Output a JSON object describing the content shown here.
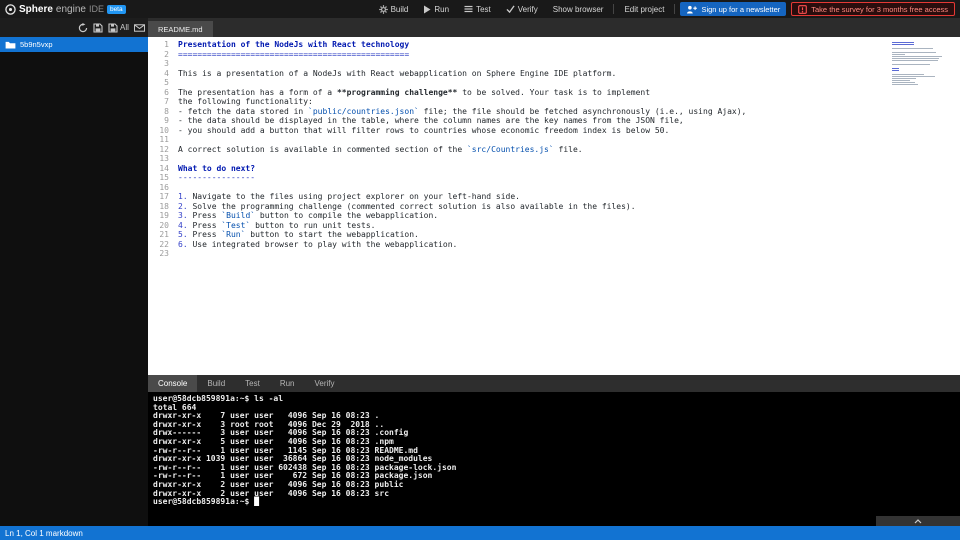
{
  "topbar": {
    "brand": {
      "name": "Sphere",
      "sub": "engine",
      "product": "IDE",
      "beta": "beta"
    },
    "actions": [
      {
        "label": "Build"
      },
      {
        "label": "Run"
      },
      {
        "label": "Test"
      },
      {
        "label": "Verify"
      },
      {
        "label": "Show browser"
      },
      {
        "label": "Edit project"
      }
    ],
    "newsletter_button": "Sign up for a newsletter",
    "survey_button": "Take the survey for 3 months free access"
  },
  "toolbar": {
    "save_all_label": "All"
  },
  "sidebar": {
    "items": [
      {
        "label": "5b9n5vxp"
      }
    ]
  },
  "editor": {
    "tab": "README.md",
    "lines": [
      [
        {
          "t": "Presentation of the NodeJs with React technology",
          "s": "h"
        }
      ],
      [
        {
          "t": "================================================",
          "s": "punct"
        }
      ],
      [],
      [
        {
          "t": "This is a presentation of a NodeJs with React webapplication on Sphere Engine IDE platform."
        }
      ],
      [],
      [
        {
          "t": "The presentation has a form of a "
        },
        {
          "t": "**programming challenge**",
          "s": "b"
        },
        {
          "t": " to be solved. Your task is to implement"
        }
      ],
      [
        {
          "t": "the following functionality:"
        }
      ],
      [
        {
          "t": "- fetch the data stored in "
        },
        {
          "t": "`public/countries.json`",
          "s": "code"
        },
        {
          "t": " file; the file should be fetched asynchronously (i.e., using Ajax),"
        }
      ],
      [
        {
          "t": "- the data should be displayed in the table, where the column names are the key names from the JSON file,"
        }
      ],
      [
        {
          "t": "- you should add a button that will filter rows to countries whose economic freedom index is below 50."
        }
      ],
      [],
      [
        {
          "t": "A correct solution is available in commented section of the "
        },
        {
          "t": "`src/Countries.js`",
          "s": "code"
        },
        {
          "t": " file."
        }
      ],
      [],
      [
        {
          "t": "What to do next?",
          "s": "h"
        }
      ],
      [
        {
          "t": "----------------",
          "s": "punct"
        }
      ],
      [],
      [
        {
          "t": "1.",
          "s": "num"
        },
        {
          "t": " Navigate to the files using project explorer on your left-hand side."
        }
      ],
      [
        {
          "t": "2.",
          "s": "num"
        },
        {
          "t": " Solve the programming challenge (commented correct solution is also available in the files)."
        }
      ],
      [
        {
          "t": "3.",
          "s": "num"
        },
        {
          "t": " Press "
        },
        {
          "t": "`Build`",
          "s": "code"
        },
        {
          "t": " button to compile the webapplication."
        }
      ],
      [
        {
          "t": "4.",
          "s": "num"
        },
        {
          "t": " Press "
        },
        {
          "t": "`Test`",
          "s": "code"
        },
        {
          "t": " button to run unit tests."
        }
      ],
      [
        {
          "t": "5.",
          "s": "num"
        },
        {
          "t": " Press "
        },
        {
          "t": "`Run`",
          "s": "code"
        },
        {
          "t": " button to start the webapplication."
        }
      ],
      [
        {
          "t": "6.",
          "s": "num"
        },
        {
          "t": " Use integrated browser to play with the webapplication."
        }
      ],
      []
    ]
  },
  "panel": {
    "tabs": [
      "Console",
      "Build",
      "Test",
      "Run",
      "Verify"
    ],
    "active_tab": "Console"
  },
  "terminal": {
    "cursor": true,
    "lines": [
      "user@58dcb859891a:~$ ls -al",
      "total 664",
      "drwxr-xr-x    7 user user   4096 Sep 16 08:23 .",
      "drwxr-xr-x    3 root root   4096 Dec 29  2018 ..",
      "drwx------    3 user user   4096 Sep 16 08:23 .config",
      "drwxr-xr-x    5 user user   4096 Sep 16 08:23 .npm",
      "-rw-r--r--    1 user user   1145 Sep 16 08:23 README.md",
      "drwxr-xr-x 1039 user user  36864 Sep 16 08:23 node_modules",
      "-rw-r--r--    1 user user 602438 Sep 16 08:23 package-lock.json",
      "-rw-r--r--    1 user user    672 Sep 16 08:23 package.json",
      "drwxr-xr-x    2 user user   4096 Sep 16 08:23 public",
      "drwxr-xr-x    2 user user   4096 Sep 16 08:23 src",
      "user@58dcb859891a:~$ "
    ]
  },
  "statusbar": {
    "text": "Ln 1, Col 1 markdown"
  }
}
